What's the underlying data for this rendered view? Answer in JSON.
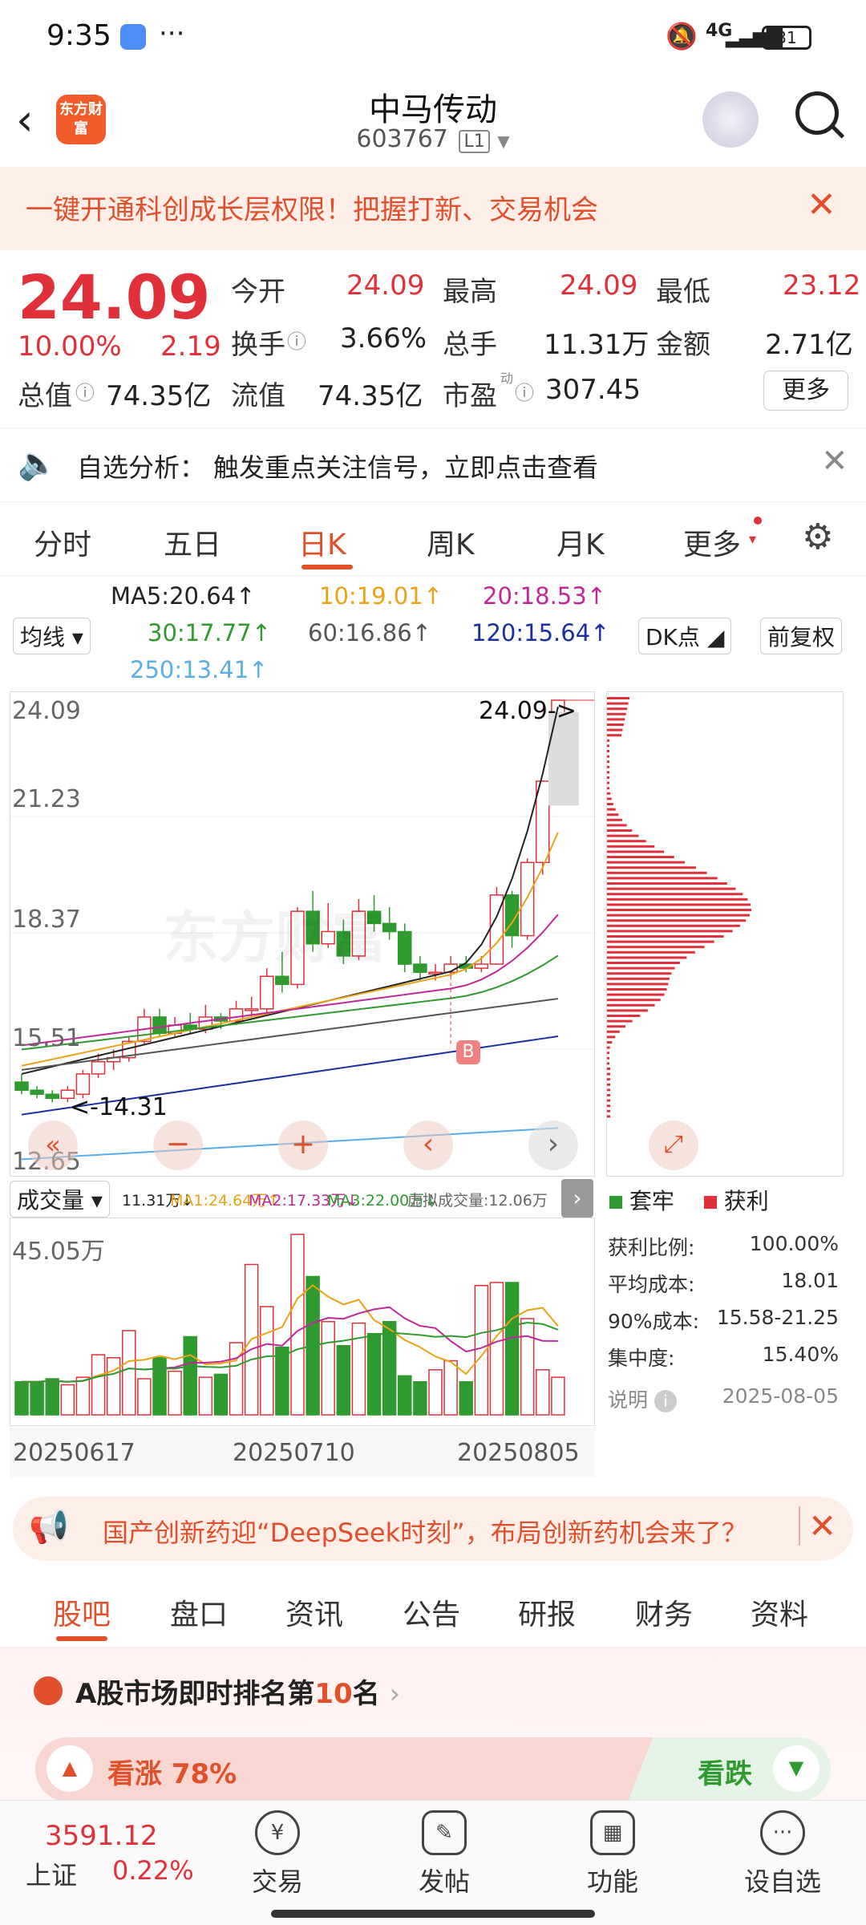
{
  "status_bar": {
    "time": "9:35",
    "net": "4G",
    "battery": "31"
  },
  "header": {
    "name": "中马传动",
    "code": "603767",
    "level": "L1",
    "logo_text": "东方财富"
  },
  "banner": {
    "text": "一键开通科创成长层权限！把握打新、交易机会"
  },
  "quote": {
    "price": "24.09",
    "pct": "10.00%",
    "chg": "2.19",
    "open_label": "今开",
    "open": "24.09",
    "high_label": "最高",
    "high": "24.09",
    "low_label": "最低",
    "low": "23.12",
    "turnover_label": "换手",
    "turnover": "3.66%",
    "volume_label": "总手",
    "volume": "11.31万",
    "amount_label": "金额",
    "amount": "2.71亿",
    "mktcap_label": "总值",
    "mktcap": "74.35亿",
    "float_label": "流值",
    "float": "74.35亿",
    "pe_label": "市盈",
    "pe_sup": "动",
    "pe": "307.45",
    "more": "更多"
  },
  "analysis": {
    "label": "自选分析：",
    "text": "触发重点关注信号，立即点击查看"
  },
  "ktabs": [
    "分时",
    "五日",
    "日K",
    "周K",
    "月K",
    "更多"
  ],
  "ma": {
    "selector": "均线",
    "ma5": "MA5:20.64↑",
    "ma10": "10:19.01↑",
    "ma20": "20:18.53↑",
    "ma30": "30:17.77↑",
    "ma60": "60:16.86↑",
    "ma120": "120:15.64↑",
    "ma250": "250:13.41↑",
    "dk": "DK点",
    "adjust": "前复权",
    "colors": {
      "ma5": "#222222",
      "ma10": "#e8a317",
      "ma20": "#c0289a",
      "ma30": "#2f9a2f",
      "ma60": "#555555",
      "ma120": "#1b2fa0",
      "ma250": "#5aaee8"
    }
  },
  "kchart": {
    "y_labels": [
      "24.09",
      "21.23",
      "18.37",
      "15.51",
      "12.65"
    ],
    "last_price_tag": "24.09->",
    "low_tag": "<-14.31",
    "buy_marker": "B",
    "watermark": "东方财富"
  },
  "dist_legend": {
    "trapped": "套牢",
    "profit": "获利"
  },
  "volume": {
    "selector": "成交量",
    "vol": "11.31万↓",
    "ma1": "MA1:24.64万↑",
    "ma2": "MA2:17.33万↓",
    "ma3": "MA3:22.00万↓",
    "virtual": "虚拟成交量:12.06万",
    "max": "45.05万"
  },
  "dates": [
    "20250617",
    "20250710",
    "20250805"
  ],
  "cost": {
    "profit_ratio_label": "获利比例:",
    "profit_ratio": "100.00%",
    "avg_cost_label": "平均成本:",
    "avg_cost": "18.01",
    "cost90_label": "90%成本:",
    "cost90": "15.58-21.25",
    "concentration_label": "集中度:",
    "concentration": "15.40%",
    "explain": "说明",
    "date": "2025-08-05"
  },
  "news": {
    "text": "国产创新药迎“DeepSeek时刻”，布局创新药机会来了？"
  },
  "subtabs": [
    "股吧",
    "盘口",
    "资讯",
    "公告",
    "研报",
    "财务",
    "资料"
  ],
  "rank": {
    "prefix": "A股市场即时排名第",
    "num": "10",
    "suffix": "名",
    "up": "看涨 78%",
    "down": "看跌"
  },
  "bottom_nav": {
    "index_value": "3591.12",
    "index_name": "上证",
    "index_pct": "0.22%",
    "items": [
      "交易",
      "发帖",
      "功能",
      "设自选"
    ]
  }
}
